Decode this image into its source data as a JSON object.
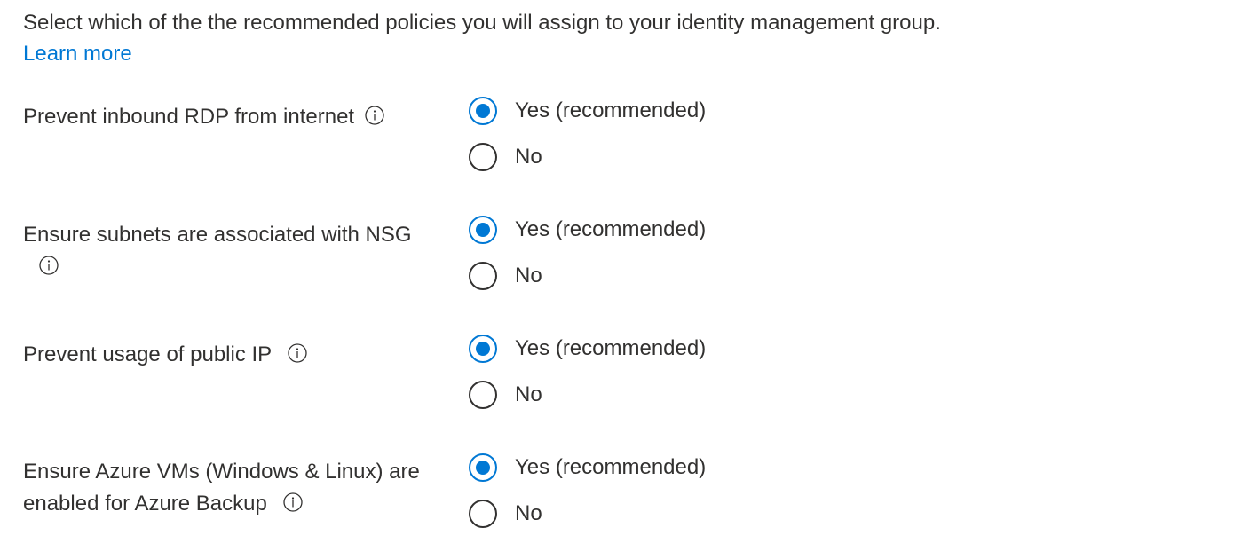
{
  "intro_text": "Select which of the the recommended policies you will assign to your identity management group.",
  "learn_more_label": "Learn more",
  "accent_color": "#0078d4",
  "text_color": "#323130",
  "info_icon": "info-circle-icon",
  "policies": [
    {
      "label": "Prevent inbound RDP from internet",
      "options": [
        "Yes (recommended)",
        "No"
      ],
      "selected": "Yes (recommended)"
    },
    {
      "label": "Ensure subnets are associated with NSG",
      "options": [
        "Yes (recommended)",
        "No"
      ],
      "selected": "Yes (recommended)"
    },
    {
      "label": "Prevent usage of public IP",
      "options": [
        "Yes (recommended)",
        "No"
      ],
      "selected": "Yes (recommended)"
    },
    {
      "label": "Ensure Azure VMs (Windows & Linux) are enabled for Azure Backup",
      "options": [
        "Yes (recommended)",
        "No"
      ],
      "selected": "Yes (recommended)"
    }
  ]
}
